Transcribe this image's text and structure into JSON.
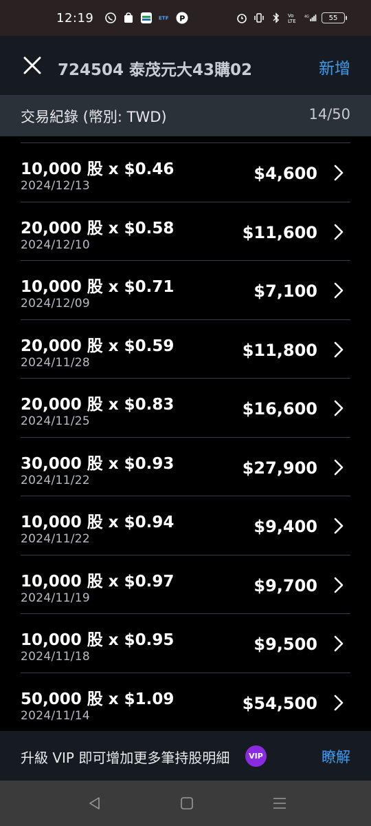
{
  "status_bar": {
    "time": "12:19",
    "battery": "55",
    "network": "4G"
  },
  "header": {
    "title": "724504 泰茂元大43購02",
    "add_label": "新增"
  },
  "section": {
    "title": "交易紀錄 (幣別: TWD)",
    "count": "14/50"
  },
  "transactions": [
    {
      "main": "10,000 股 x $0.46",
      "date": "2024/12/13",
      "amount": "$4,600"
    },
    {
      "main": "20,000 股 x $0.58",
      "date": "2024/12/10",
      "amount": "$11,600"
    },
    {
      "main": "10,000 股 x $0.71",
      "date": "2024/12/09",
      "amount": "$7,100"
    },
    {
      "main": "20,000 股 x $0.59",
      "date": "2024/11/28",
      "amount": "$11,800"
    },
    {
      "main": "20,000 股 x $0.83",
      "date": "2024/11/25",
      "amount": "$16,600"
    },
    {
      "main": "30,000 股 x $0.93",
      "date": "2024/11/22",
      "amount": "$27,900"
    },
    {
      "main": "10,000 股 x $0.94",
      "date": "2024/11/22",
      "amount": "$9,400"
    },
    {
      "main": "10,000 股 x $0.97",
      "date": "2024/11/19",
      "amount": "$9,700"
    },
    {
      "main": "10,000 股 x $0.95",
      "date": "2024/11/18",
      "amount": "$9,500"
    },
    {
      "main": "50,000 股 x $1.09",
      "date": "2024/11/14",
      "amount": "$54,500"
    }
  ],
  "vip": {
    "text": "升級 VIP 即可增加更多筆持股明細",
    "badge": "VIP",
    "link": "瞭解"
  },
  "colors": {
    "accent": "#3d9bf0",
    "vip_purple": "#8a2be2",
    "header_bg": "#161b21",
    "section_bg": "#2b3138"
  }
}
